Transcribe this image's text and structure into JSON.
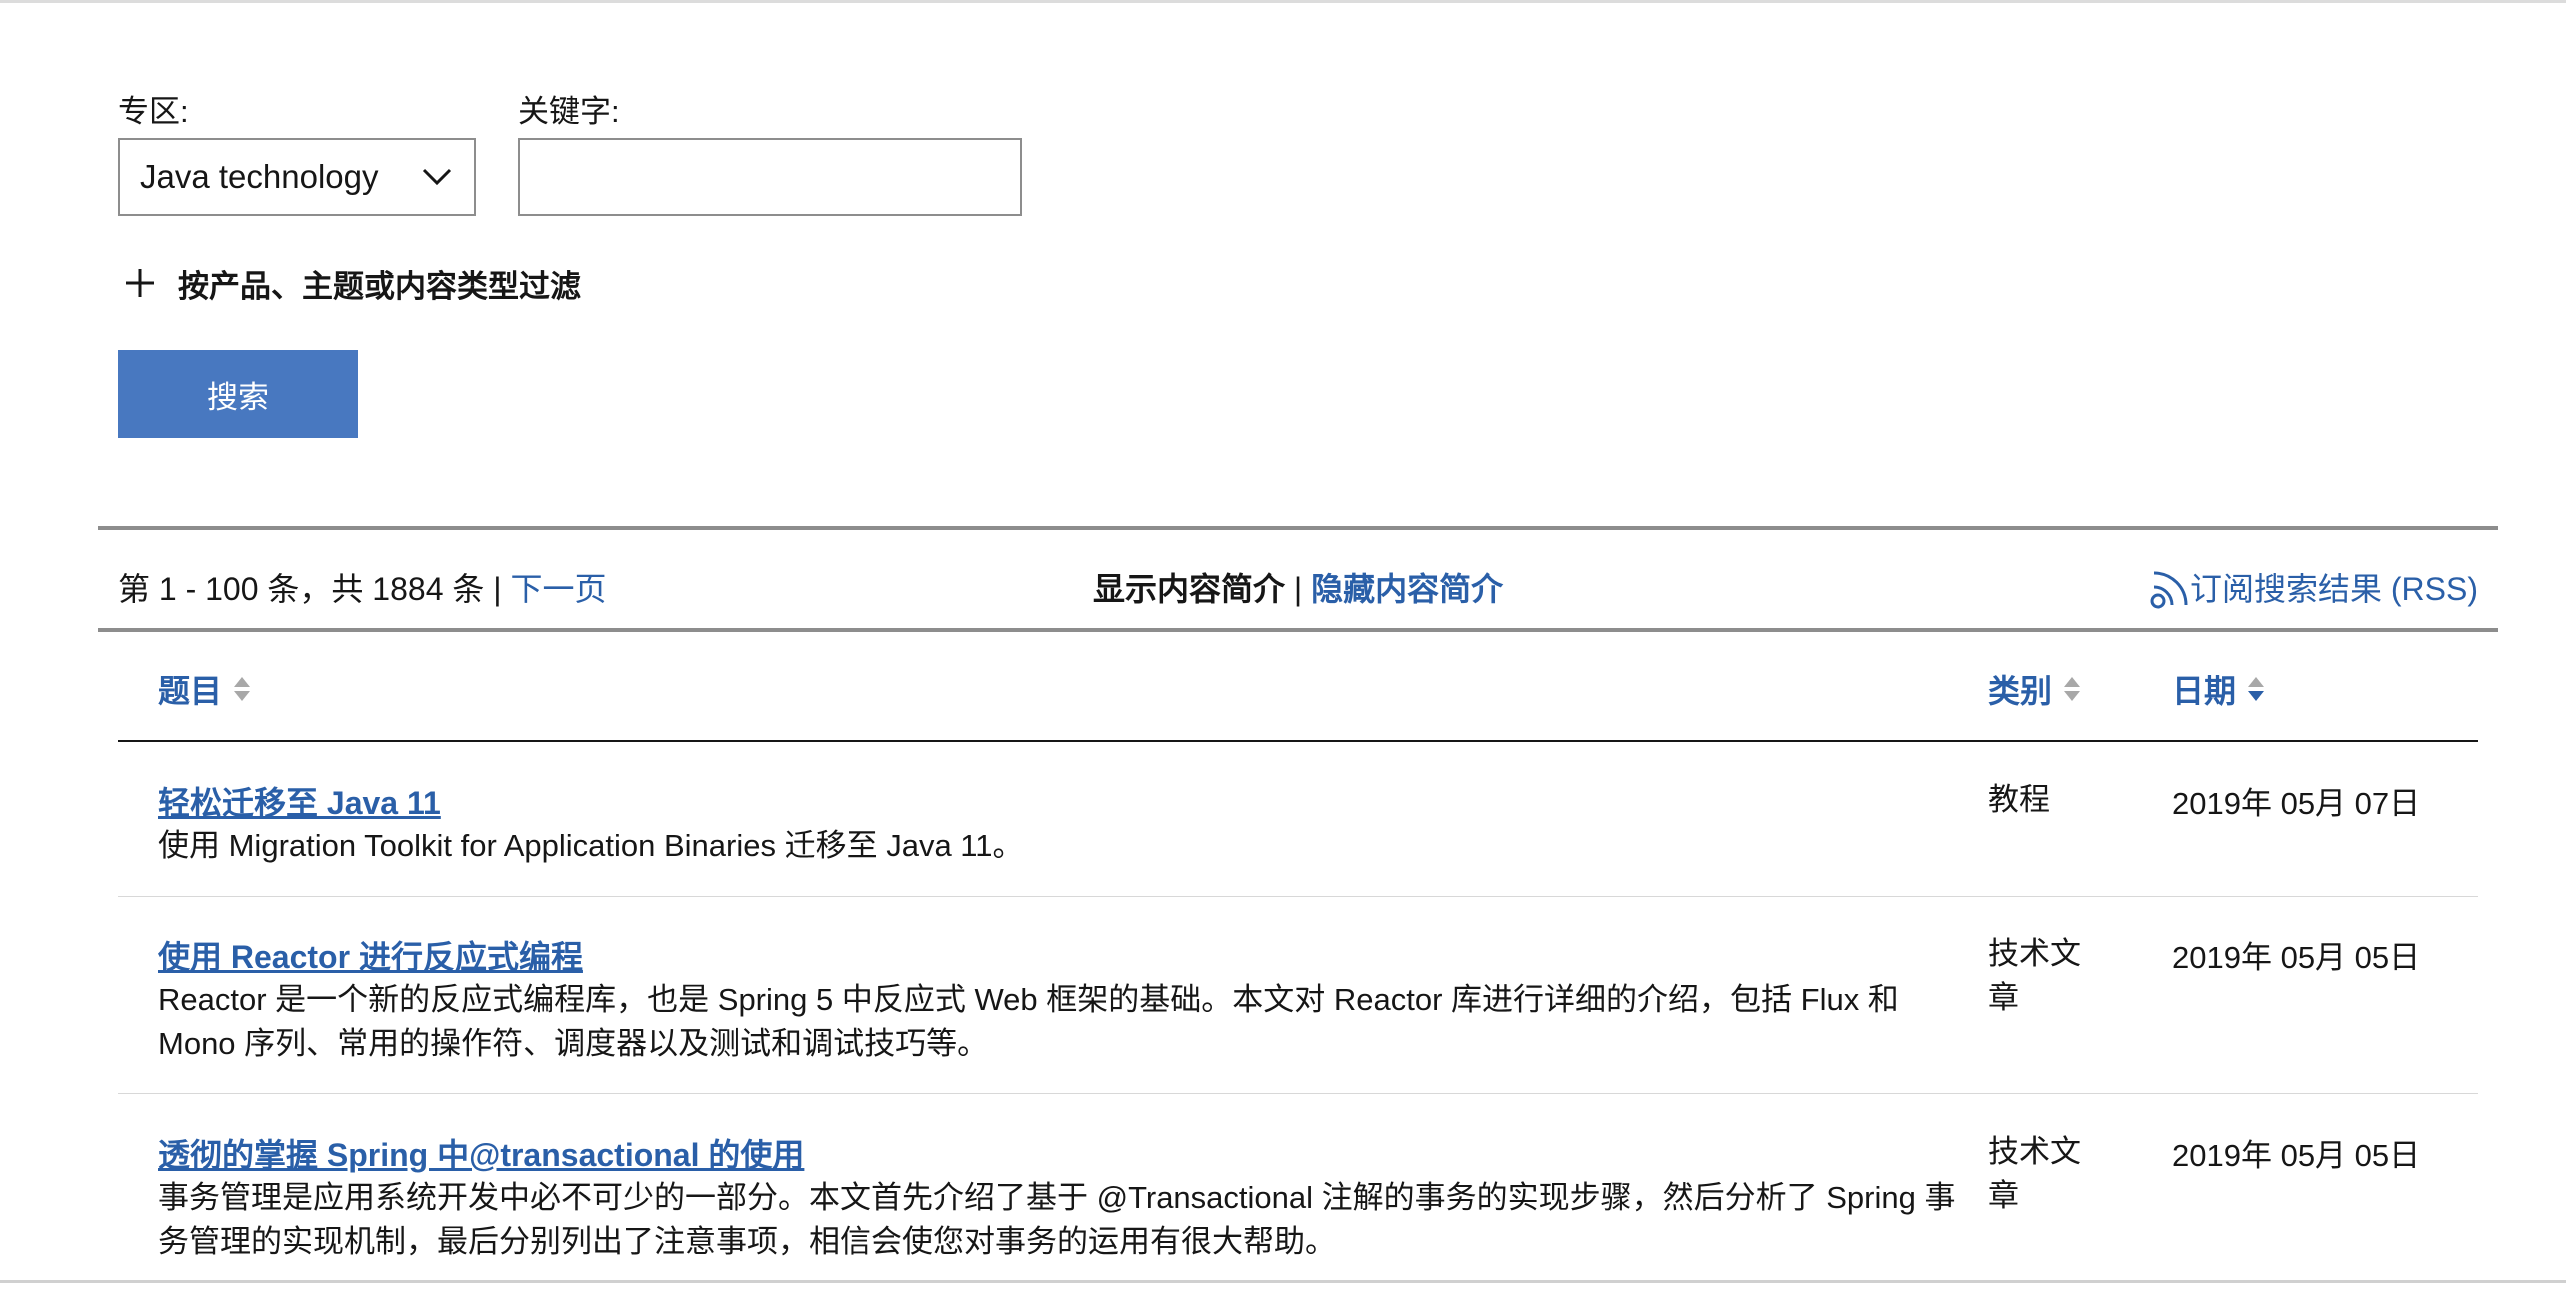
{
  "filters": {
    "zone_label": "专区:",
    "zone_selected": "Java technology",
    "keyword_label": "关键字:",
    "keyword_value": "",
    "filter_toggle": "按产品、主题或内容类型过滤",
    "search_button": "搜索"
  },
  "results_bar": {
    "count_text": "第 1 - 100 条，共 1884 条 |",
    "next_page": "下一页",
    "show_summary": "显示内容简介",
    "separator": "|",
    "hide_summary": "隐藏内容简介",
    "rss": "订阅搜索结果 (RSS)"
  },
  "table": {
    "columns": [
      "题目",
      "类别",
      "日期"
    ],
    "rows": [
      {
        "title": "轻松迁移至 Java 11",
        "description": "使用 Migration Toolkit for Application Binaries 迁移至 Java 11。",
        "category": "教程",
        "date": "2019年 05月 07日"
      },
      {
        "title": "使用 Reactor 进行反应式编程",
        "description": "Reactor 是一个新的反应式编程库，也是 Spring 5 中反应式 Web 框架的基础。本文对 Reactor 库进行详细的介绍，包括 Flux 和 Mono 序列、常用的操作符、调度器以及测试和调试技巧等。",
        "category": "技术文章",
        "date": "2019年 05月 05日"
      },
      {
        "title": "透彻的掌握 Spring 中@transactional 的使用",
        "description": "事务管理是应用系统开发中必不可少的一部分。本文首先介绍了基于 @Transactional 注解的事务的实现步骤，然后分析了 Spring 事务管理的实现机制，最后分别列出了注意事项，相信会使您对事务的运用有很大帮助。",
        "category": "技术文章",
        "date": "2019年 05月 05日"
      }
    ]
  },
  "colors": {
    "link": "#2a5fa8",
    "button": "#4878c0"
  }
}
